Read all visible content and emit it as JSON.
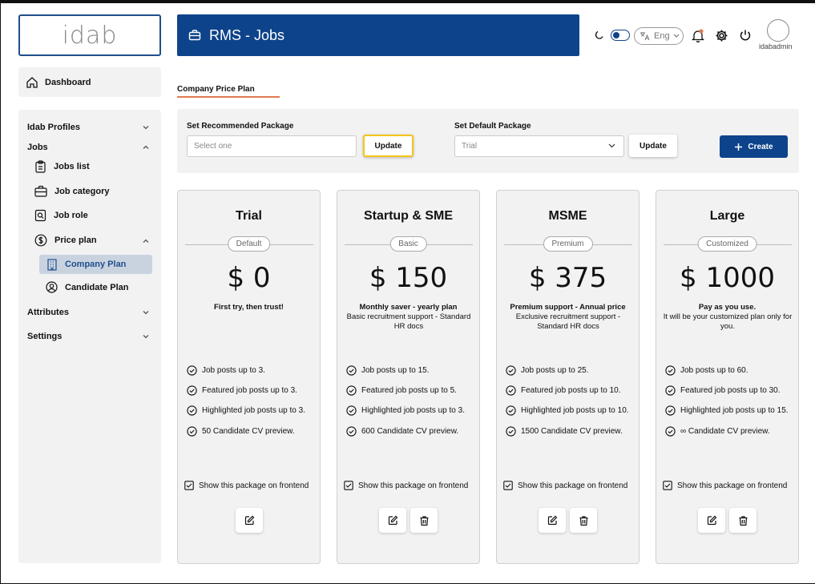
{
  "app": {
    "logo_text": "idab",
    "title": "RMS - Jobs"
  },
  "header": {
    "language": "Eng",
    "username": "idabadmin",
    "accent": "#0d438a",
    "notification_dot": "#e07a4f"
  },
  "sidebar": {
    "dashboard": "Dashboard",
    "idab_profiles": "Idab Profiles",
    "jobs": "Jobs",
    "jobs_list": "Jobs list",
    "job_category": "Job category",
    "job_role": "Job role",
    "price_plan": "Price plan",
    "company_plan": "Company Plan",
    "candidate_plan": "Candidate Plan",
    "attributes": "Attributes",
    "settings": "Settings"
  },
  "tab": {
    "label": "Company Price Plan"
  },
  "package_bar": {
    "recommended_label": "Set Recommended Package",
    "recommended_placeholder": "Select one",
    "default_label": "Set Default Package",
    "default_value": "Trial",
    "update_label": "Update",
    "create_label": "Create"
  },
  "cards": [
    {
      "name": "Trial",
      "tier": "Default",
      "price": "$ 0",
      "tagline": "First try, then trust!",
      "description": "",
      "features": [
        "Job posts up to 3.",
        "Featured job posts up to 3.",
        "Highlighted job posts up to 3.",
        "50 Candidate CV preview."
      ],
      "show_frontend": "Show this package on frontend"
    },
    {
      "name": "Startup & SME",
      "tier": "Basic",
      "price": "$ 150",
      "tagline": "Monthly saver - yearly plan",
      "description": "Basic recruitment support - Standard HR docs",
      "features": [
        "Job posts up to 15.",
        "Featured job posts up to 5.",
        "Highlighted job posts up to 3.",
        "600 Candidate CV preview."
      ],
      "show_frontend": "Show this package on frontend"
    },
    {
      "name": "MSME",
      "tier": "Premium",
      "price": "$ 375",
      "tagline": "Premium support - Annual price",
      "description": "Exclusive recruitment support - Standard HR docs",
      "features": [
        "Job posts up to 25.",
        "Featured job posts up to 10.",
        "Highlighted job posts up to 10.",
        "1500 Candidate CV preview."
      ],
      "show_frontend": "Show this package on frontend"
    },
    {
      "name": "Large",
      "tier": "Customized",
      "price": "$ 1000",
      "tagline": "Pay as you use.",
      "description": "It will be your customized plan only for you.",
      "features": [
        "Job posts up to 60.",
        "Featured job posts up to 30.",
        "Highlighted job posts up to 15.",
        "∞ Candidate CV preview."
      ],
      "show_frontend": "Show this package on frontend"
    }
  ]
}
